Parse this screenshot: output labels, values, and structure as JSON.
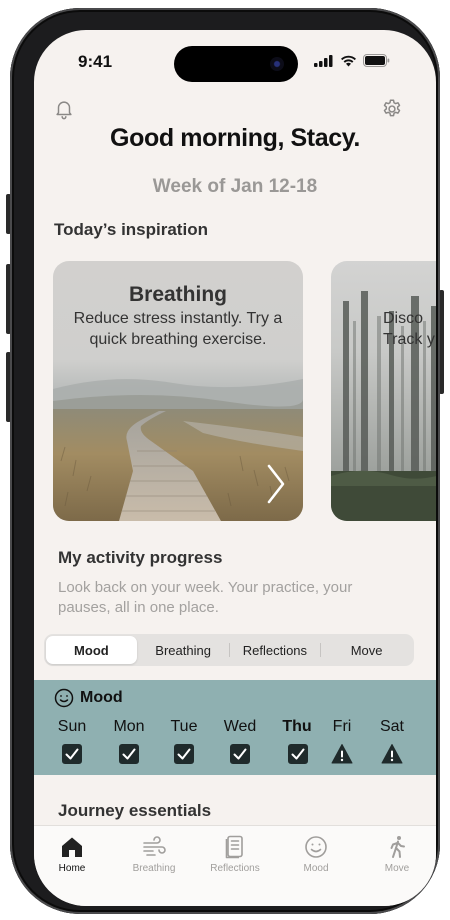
{
  "status_bar": {
    "time": "9:41"
  },
  "header": {
    "greeting": "Good morning, Stacy.",
    "week": "Week of Jan 12-18"
  },
  "inspiration": {
    "title": "Today’s inspiration",
    "cards": [
      {
        "title": "Breathing",
        "description": "Reduce stress instantly. Try a quick breathing exercise."
      },
      {
        "title": "",
        "description": "Disco\nTrack y"
      }
    ]
  },
  "activity": {
    "title": "My activity progress",
    "description": "Look back on your week. Your practice, your pauses, all in one place.",
    "tabs": [
      "Mood",
      "Breathing",
      "Reflections",
      "Move"
    ],
    "active_tab": "Mood"
  },
  "mood": {
    "title": "Mood",
    "days": [
      {
        "label": "Sun",
        "status": "check"
      },
      {
        "label": "Mon",
        "status": "check"
      },
      {
        "label": "Tue",
        "status": "check"
      },
      {
        "label": "Wed",
        "status": "check"
      },
      {
        "label": "Thu",
        "status": "check",
        "current": true
      },
      {
        "label": "Fri",
        "status": "warning"
      },
      {
        "label": "Sat",
        "status": "warning"
      }
    ]
  },
  "journey": {
    "title": "Journey essentials"
  },
  "tabbar": {
    "items": [
      {
        "label": "Home",
        "icon": "home-icon",
        "active": true
      },
      {
        "label": "Breathing",
        "icon": "wind-icon"
      },
      {
        "label": "Reflections",
        "icon": "journal-icon"
      },
      {
        "label": "Mood",
        "icon": "smile-icon"
      },
      {
        "label": "Move",
        "icon": "figure-walk-icon"
      }
    ]
  },
  "colors": {
    "background": "#f6f2ef",
    "mood_panel": "#8fb0b1",
    "text_primary": "#111111",
    "text_muted": "#9a9896"
  }
}
